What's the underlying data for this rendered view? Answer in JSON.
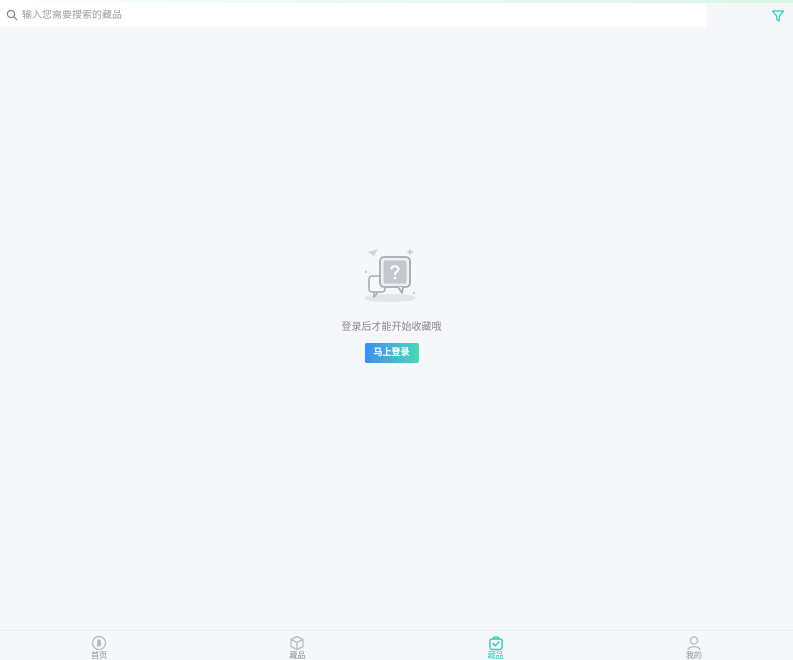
{
  "search": {
    "placeholder": "输入您需要搜索的藏品"
  },
  "filter": {
    "icon": "filter-icon"
  },
  "empty_state": {
    "icon": "question-chat-icon",
    "message": "登录后才能开始收藏哦",
    "button_label": "马上登录"
  },
  "tabbar": {
    "items": [
      {
        "label": "首页",
        "icon": "home-icon",
        "active": false
      },
      {
        "label": "藏品",
        "icon": "box-icon",
        "active": false
      },
      {
        "label": "藏品",
        "icon": "bag-icon",
        "active": true
      },
      {
        "label": "我的",
        "icon": "user-icon",
        "active": false
      }
    ]
  },
  "colors": {
    "accent": "#2fc7c0",
    "button_start": "#3b8ff0",
    "button_end": "#4bd7b7",
    "background": "#f5f7fb"
  }
}
